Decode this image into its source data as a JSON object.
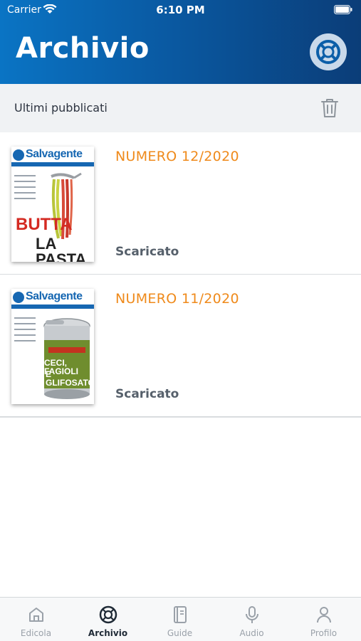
{
  "status_bar": {
    "carrier": "Carrier",
    "time": "6:10 PM"
  },
  "header": {
    "title": "Archivio",
    "help_icon": "lifebuoy-icon"
  },
  "section": {
    "title": "Ultimi pubblicati",
    "delete_icon": "trash-icon"
  },
  "issues": [
    {
      "title": "NUMERO 12/2020",
      "status": "Scaricato",
      "cover_logo": "Salvagente",
      "cover_headline_top": "BUTTA",
      "cover_headline_bottom": "LA PASTA"
    },
    {
      "title": "NUMERO 11/2020",
      "status": "Scaricato",
      "cover_logo": "Salvagente",
      "cover_headline_top": "CECI, FAGIOLI",
      "cover_headline_bottom": "E GLIFOSATO"
    }
  ],
  "tabs": [
    {
      "label": "Edicola",
      "icon": "home-icon",
      "active": false
    },
    {
      "label": "Archivio",
      "icon": "lifebuoy-icon",
      "active": true
    },
    {
      "label": "Guide",
      "icon": "book-icon",
      "active": false
    },
    {
      "label": "Audio",
      "icon": "microphone-icon",
      "active": false
    },
    {
      "label": "Profilo",
      "icon": "person-icon",
      "active": false
    }
  ],
  "colors": {
    "header_start": "#0a74c4",
    "header_end": "#0b3d78",
    "accent_orange": "#ef8a1b",
    "status_text": "#56606b",
    "tab_inactive": "#9aa1a9",
    "tab_active": "#1f2a36"
  }
}
